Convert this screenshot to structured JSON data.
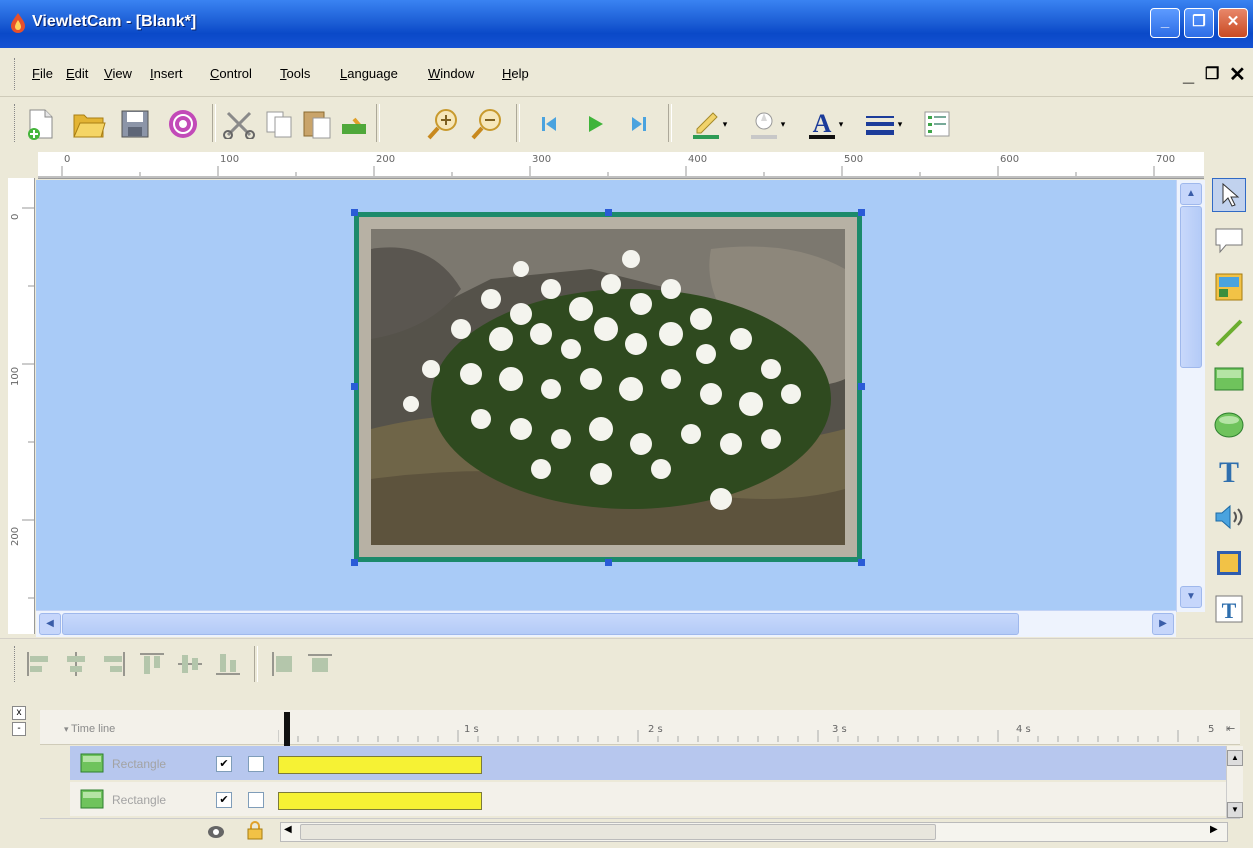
{
  "window": {
    "title": "ViewletCam - [Blank*]"
  },
  "menu": {
    "items": [
      "File",
      "Edit",
      "View",
      "Insert",
      "Control",
      "Tools",
      "Language",
      "Window",
      "Help"
    ]
  },
  "toolbar": {
    "icons": [
      "new-file-icon",
      "open-folder-icon",
      "save-icon",
      "record-icon",
      "cut-icon",
      "copy-icon",
      "paste-icon",
      "undo-icon",
      "zoom-in-icon",
      "zoom-out-icon",
      "skip-back-icon",
      "play-icon",
      "skip-forward-icon",
      "line-color-icon",
      "fill-color-icon",
      "font-color-icon",
      "line-style-icon",
      "properties-icon"
    ]
  },
  "ruler": {
    "top_labels": [
      "0",
      "100",
      "200",
      "300",
      "400",
      "500",
      "600",
      "700"
    ],
    "left_labels": [
      "0",
      "100",
      "200"
    ]
  },
  "tools": [
    "pointer-icon",
    "callout-icon",
    "image-icon",
    "line-icon",
    "rectangle-icon",
    "ellipse-icon",
    "text-icon",
    "sound-icon",
    "picture-icon",
    "textbox-icon"
  ],
  "timeline": {
    "header_label": "Time line",
    "time_marks": [
      "1 s",
      "2 s",
      "3 s",
      "4 s",
      "5"
    ],
    "layers": [
      {
        "name": "Rectangle",
        "visible_checked": true,
        "locked_checked": false
      },
      {
        "name": "Rectangle",
        "visible_checked": true,
        "locked_checked": false
      }
    ]
  },
  "colors": {
    "titlebar": "#1d5fd6",
    "canvas": "#a9cbf7",
    "frame_border": "#1c8a6b",
    "selected_row": "#b7c7ee",
    "timeline_bar": "#f6f234"
  }
}
